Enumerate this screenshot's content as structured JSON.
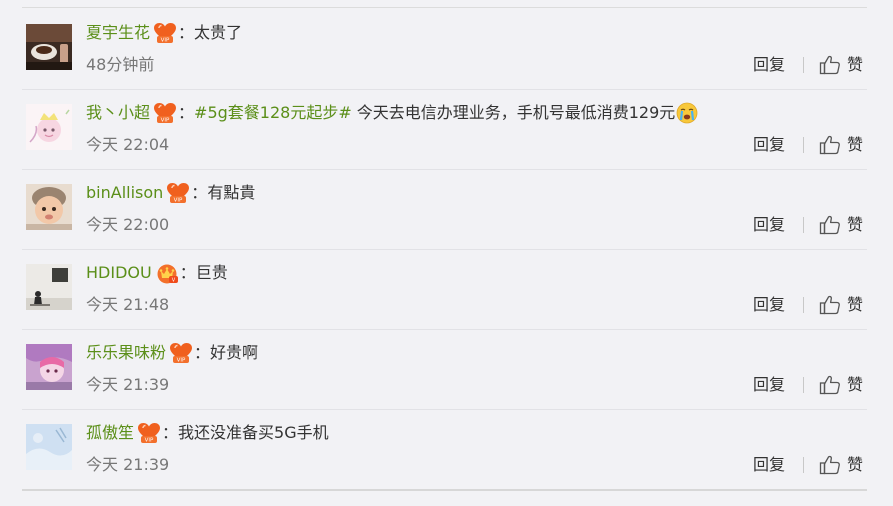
{
  "ui": {
    "reply_label": "回复",
    "like_label": "赞",
    "colon": "："
  },
  "comments": [
    {
      "username": "夏宇生花",
      "badge_icon": "vip-heart-badge-icon",
      "topic": "",
      "text": "太贵了",
      "emoji": "",
      "time": "48分钟前"
    },
    {
      "username": "我丶小超",
      "badge_icon": "vip-heart-badge-icon",
      "topic": "#5g套餐128元起步#",
      "text": "今天去电信办理业务，手机号最低消费129元",
      "emoji": "crying-face-emoji",
      "time": "今天 22:04"
    },
    {
      "username": "binAllison",
      "badge_icon": "vip-heart-badge-icon",
      "topic": "",
      "text": "有點貴",
      "emoji": "",
      "time": "今天 22:00"
    },
    {
      "username": "HDIDOU",
      "badge_icon": "crown-badge-icon",
      "topic": "",
      "text": "巨贵",
      "emoji": "",
      "time": "今天 21:48"
    },
    {
      "username": "乐乐果味粉",
      "badge_icon": "vip-heart-badge-icon",
      "topic": "",
      "text": "好贵啊",
      "emoji": "",
      "time": "今天 21:39"
    },
    {
      "username": "孤傲笙",
      "badge_icon": "vip-heart-badge-icon",
      "topic": "",
      "text": "我还没准备买5G手机",
      "emoji": "",
      "time": "今天 21:39"
    }
  ],
  "colors": {
    "username": "#5b8f19",
    "topic": "#5b8f19",
    "text": "#333333",
    "meta": "#777777",
    "background": "#f2f2f5",
    "vip_badge": "#f0601e"
  }
}
